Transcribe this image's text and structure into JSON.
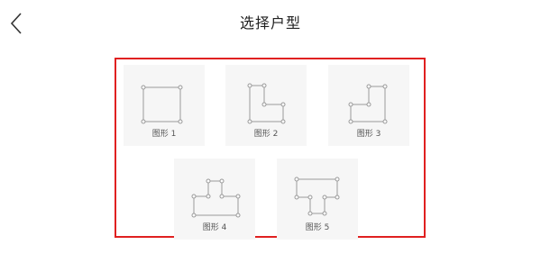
{
  "header": {
    "title": "选择户型",
    "back_icon": "chevron-left-icon"
  },
  "frame_color": "#e02020",
  "shapes": [
    {
      "label": "图形 1",
      "icon": "square-shape-icon"
    },
    {
      "label": "图形 2",
      "icon": "l-shape-icon"
    },
    {
      "label": "图形 3",
      "icon": "reverse-l-shape-icon"
    },
    {
      "label": "图形 4",
      "icon": "convex-shape-icon"
    },
    {
      "label": "图形 5",
      "icon": "t-shape-icon"
    }
  ]
}
